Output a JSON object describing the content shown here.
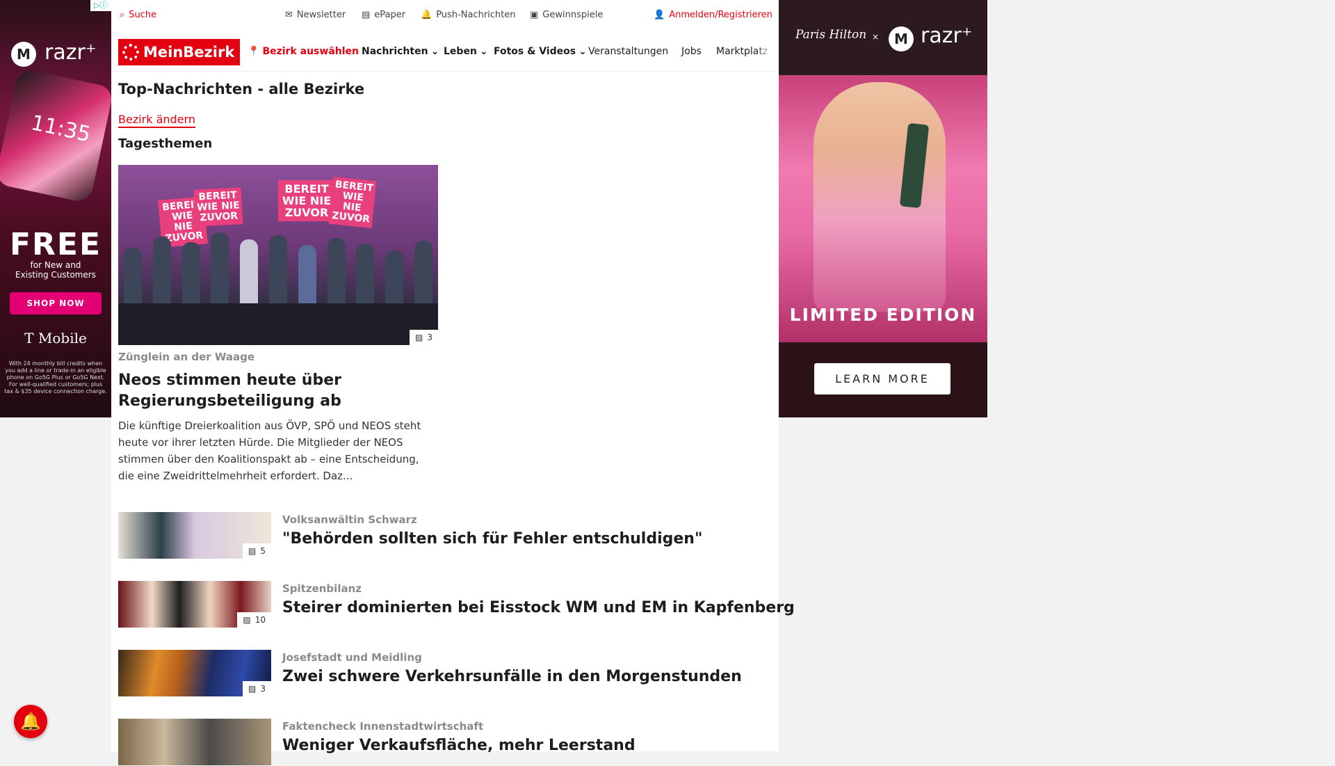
{
  "topbar": {
    "search": "Suche",
    "newsletter": "Newsletter",
    "epaper": "ePaper",
    "push": "Push-Nachrichten",
    "gewinnspiele": "Gewinnspiele",
    "login": "Anmelden/Registrieren"
  },
  "navbar": {
    "logo": "MeinBezirk",
    "bezirk": "Bezirk auswählen",
    "items": [
      "Nachrichten",
      "Leben",
      "Fotos & Videos",
      "Veranstaltungen",
      "Jobs",
      "Marktplatz"
    ]
  },
  "page": {
    "title": "Top-Nachrichten - alle Bezirke",
    "change_link": "Bezirk ändern",
    "section": "Tagesthemen"
  },
  "hero": {
    "signs": [
      "BEREIT WIE NIE ZUVOR",
      "BEREIT WIE NIE ZUVOR",
      "BEREIT WIE NIE ZUVOR",
      "BEREIT WIE NIE ZUVOR"
    ],
    "image_count": "3",
    "kicker": "Zünglein an der Waage",
    "title": "Neos stimmen heute über Regierungsbeteiligung ab",
    "teaser": "Die künftige Dreierkoalition aus ÖVP, SPÖ und NEOS steht heute vor ihrer letzten Hürde. Die Mitglieder der NEOS stimmen über den Koalitionspakt ab – eine Entscheidung, die eine Zweidrittelmehrheit erfordert. Daz..."
  },
  "articles": [
    {
      "kicker": "Volksanwältin Schwarz",
      "title": "\"Behörden sollten sich für Fehler entschuldigen\"",
      "count": "5",
      "color1": "#d7cfc4",
      "color2": "#6a5a7d"
    },
    {
      "kicker": "Spitzenbilanz",
      "title": "Steirer dominierten bei Eisstock WM und EM in Kapfenberg",
      "count": "10",
      "color1": "#7a1a1f",
      "color2": "#e9d8c8"
    },
    {
      "kicker": "Josefstadt und Meidling",
      "title": "Zwei schwere Verkehrsunfälle in den Morgenstunden",
      "count": "3",
      "color1": "#2b3a6b",
      "color2": "#d98a2e"
    },
    {
      "kicker": "Faktencheck Innenstadtwirtschaft",
      "title": "Weniger Verkaufsfläche, mehr Leerstand",
      "count": "",
      "color1": "#8a6b4a",
      "color2": "#3b3b3b"
    }
  ],
  "ad_left": {
    "brand": "razr⁺",
    "time": "11:35",
    "free": "FREE",
    "sub": "for New and Existing Customers",
    "cta": "SHOP NOW",
    "advertiser": "T Mobile",
    "disclaimer": "With 24 monthly bill credits when you add a line or trade-in an eligible phone on Go5G Plus or Go5G Next. For well-qualified customers; plus tax & $35 device connection charge."
  },
  "ad_right": {
    "signature": "Paris Hilton",
    "brand": "razr⁺",
    "edition": "LIMITED EDITION",
    "cta": "LEARN MORE"
  },
  "colors": {
    "brand_red": "#e3000f",
    "kicker_gray": "#8a8a8a"
  }
}
